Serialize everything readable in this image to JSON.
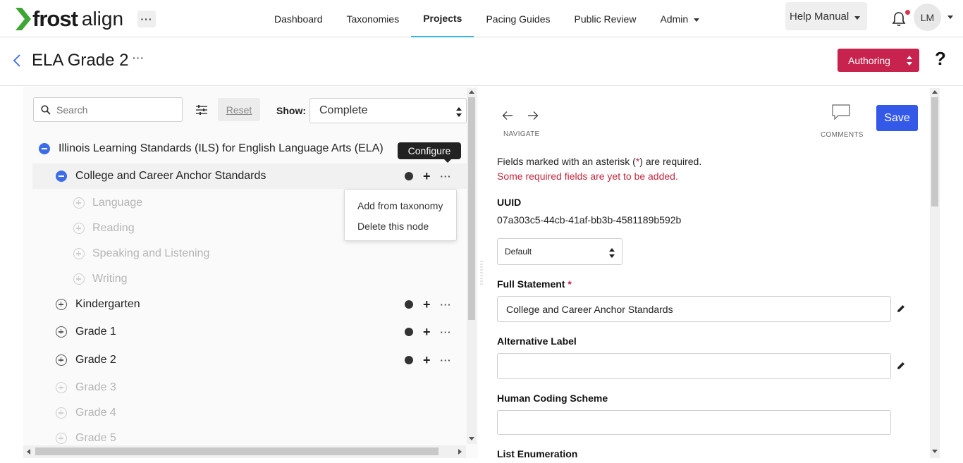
{
  "header": {
    "logo_frost": "frost",
    "logo_align": "align",
    "more": "···",
    "nav": [
      {
        "label": "Dashboard"
      },
      {
        "label": "Taxonomies"
      },
      {
        "label": "Projects"
      },
      {
        "label": "Pacing Guides"
      },
      {
        "label": "Public Review"
      },
      {
        "label": "Admin"
      }
    ],
    "help_label": "Help Manual",
    "avatar_initials": "LM"
  },
  "titlebar": {
    "title": "ELA Grade 2",
    "more": "···",
    "mode_label": "Authoring",
    "help_symbol": "?"
  },
  "tree_toolbar": {
    "search_placeholder": "Search",
    "reset_label": "Reset",
    "show_label": "Show:",
    "show_value": "Complete"
  },
  "tree": {
    "root": "Illinois Learning Standards (ILS) for English Language Arts (ELA)",
    "anchor": "College and Career Anchor Standards",
    "anchor_children": [
      "Language",
      "Reading",
      "Speaking and Listening",
      "Writing"
    ],
    "grades": [
      "Kindergarten",
      "Grade 1",
      "Grade 2"
    ],
    "faded_grades": [
      "Grade 3",
      "Grade 4",
      "Grade 5"
    ],
    "tooltip": "Configure",
    "context_menu": [
      "Add from taxonomy",
      "Delete this node"
    ],
    "more_glyph": "···",
    "plus_glyph": "+"
  },
  "detail": {
    "navigate_caption": "NAVIGATE",
    "comments_caption": "COMMENTS",
    "save_label": "Save",
    "required_note_pre": "Fields marked with an asterisk (",
    "required_note_star": "*",
    "required_note_post": ") are required.",
    "required_warning": "Some required fields are yet to be added.",
    "uuid_label": "UUID",
    "uuid_value": "07a303c5-44cb-41af-bb3b-4581189b592b",
    "type_value": "Default",
    "full_statement_label": "Full Statement",
    "full_statement_value": "College and Career Anchor Standards",
    "alt_label_label": "Alternative Label",
    "alt_label_value": "",
    "human_coding_label": "Human Coding Scheme",
    "human_coding_value": "",
    "list_enum_label": "List Enumeration",
    "required_star": "*"
  },
  "colors": {
    "brand_green": "#3fa535",
    "authoring": "#c8234e",
    "save": "#3459e9",
    "toggle_blue": "#3d6ce8",
    "nav_active": "#3db7d8"
  }
}
